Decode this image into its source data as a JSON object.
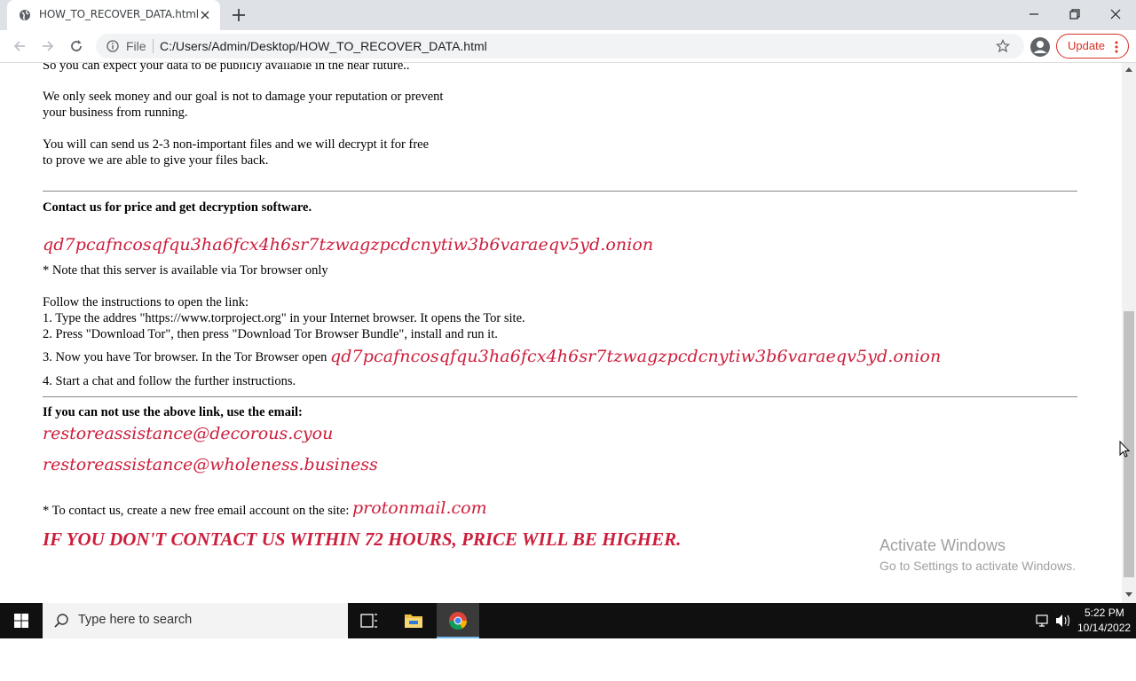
{
  "browser": {
    "tab_title": "HOW_TO_RECOVER_DATA.html",
    "scheme_label": "File",
    "url": "C:/Users/Admin/Desktop/HOW_TO_RECOVER_DATA.html",
    "update_label": "Update",
    "accent_color": "#d93025"
  },
  "page": {
    "line_cut": "So you can expect your data to be publicly available in the near future..",
    "para_money_1": "We only seek money and our goal is not to damage your reputation or prevent",
    "para_money_2": "your business from running.",
    "para_free_1": "You will can send us 2-3 non-important files and we will decrypt it for free",
    "para_free_2": "to prove we are able to give your files back.",
    "contact_heading": "Contact us for price and get decryption software.",
    "onion_address": "qd7pcafncosqfqu3ha6fcx4h6sr7tzwagzpcdcnytiw3b6varaeqv5yd.onion",
    "tor_note": "* Note that this server is available via Tor browser only",
    "follow_heading": "Follow the instructions to open the link:",
    "step_1": "1. Type the addres \"https://www.torproject.org\" in your Internet browser. It opens the Tor site.",
    "step_2": "2. Press \"Download Tor\", then press \"Download Tor Browser Bundle\", install and run it.",
    "step_3_prefix": "3. Now you have Tor browser. In the Tor Browser open",
    "step_3_onion": "qd7pcafncosqfqu3ha6fcx4h6sr7tzwagzpcdcnytiw3b6varaeqv5yd.onion",
    "step_4": "4. Start a chat and follow the further instructions.",
    "email_heading": "If you can not use the above link, use the email:",
    "email_1": "restoreassistance@decorous.cyou",
    "email_2": "restoreassistance@wholeness.business",
    "proton_prefix": "* To contact us, create a new free email account on the site:",
    "proton_site": "protonmail.com",
    "warning": "IF YOU DON'T CONTACT US WITHIN 72 HOURS, PRICE WILL BE HIGHER.",
    "highlight_color": "#cc1e3c"
  },
  "watermark": {
    "line1": "Activate Windows",
    "line2": "Go to Settings to activate Windows."
  },
  "taskbar": {
    "search_placeholder": "Type here to search",
    "time": "5:22 PM",
    "date": "10/14/2022"
  }
}
